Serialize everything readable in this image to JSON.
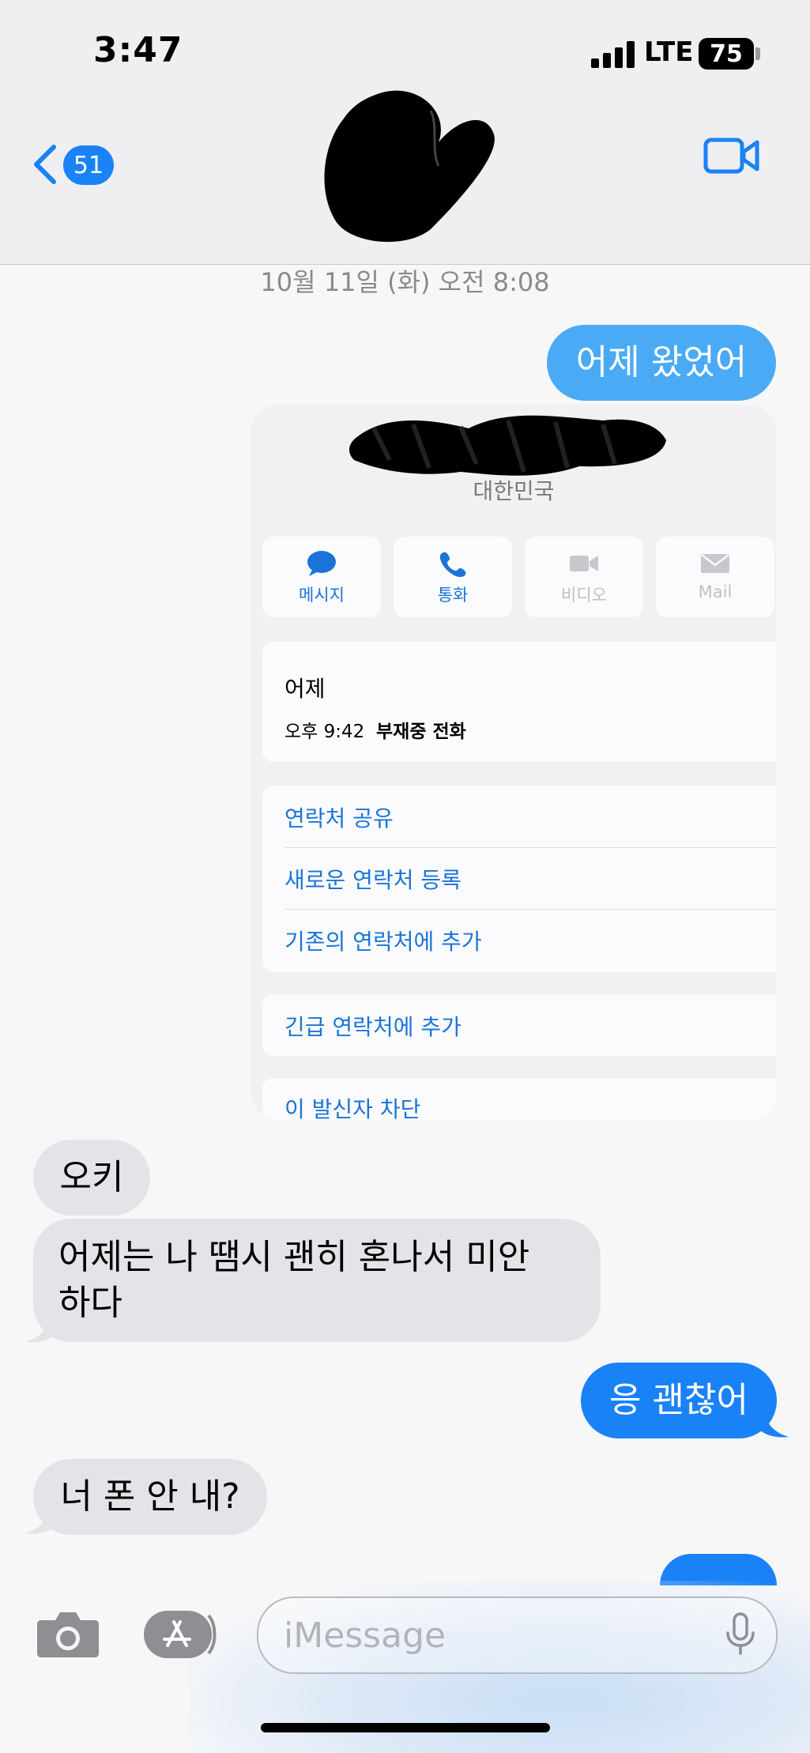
{
  "status_bar": {
    "time": "3:47",
    "network": "LTE",
    "battery": "75"
  },
  "header": {
    "back_count": "51"
  },
  "thread": {
    "timestamp": "10월 11일 (화) 오전 8:08",
    "msg1": "어제 왔었어",
    "screenshot": {
      "country": "대한민국",
      "actions": [
        "메시지",
        "통화",
        "비디오",
        "Mail"
      ],
      "recent_day": "어제",
      "recent_time": "오후 9:42",
      "recent_type": "부재중 전화",
      "share_contact": "연락처 공유",
      "new_contact": "새로운 연락처 등록",
      "add_existing": "기존의 연락처에 추가",
      "emergency": "긴급 연락처에 추가",
      "block": "이 발신자 차단"
    },
    "msg2": "오키",
    "msg3_line1": "어제는 나 땜시 괜히 혼나서 미안",
    "msg3_line2": "하다",
    "msg4": "응 괜찮어",
    "msg5": "너 폰 안 내?"
  },
  "input": {
    "placeholder": "iMessage"
  },
  "colors": {
    "accent": "#1a82f7",
    "incoming": "#e4e4e8",
    "destructive": "#e5483d"
  },
  "icons": [
    "back-chevron-icon",
    "video-call-icon",
    "camera-icon",
    "app-store-icon",
    "microphone-icon",
    "message-icon",
    "phone-icon",
    "video-icon",
    "mail-icon"
  ]
}
